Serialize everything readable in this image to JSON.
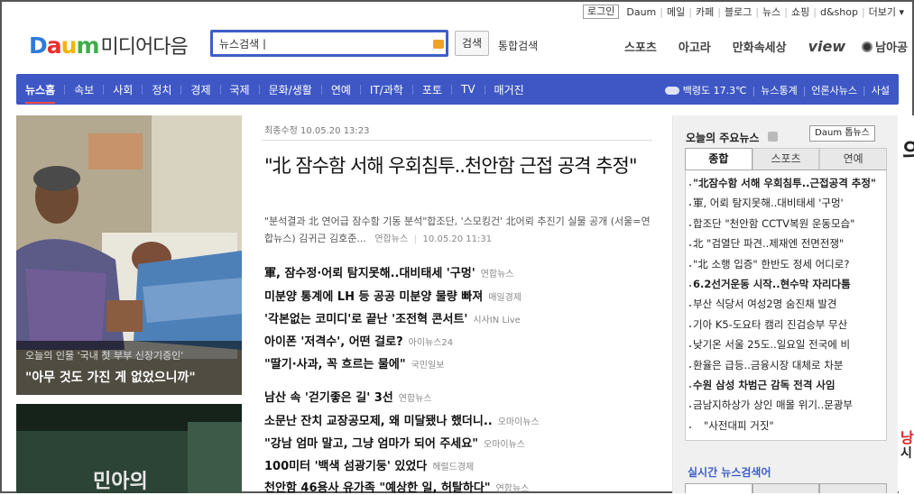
{
  "toplinks": {
    "login": "로그인",
    "items": [
      "Daum",
      "메일",
      "카페",
      "블로그",
      "뉴스",
      "쇼핑",
      "d&shop",
      "더보기"
    ]
  },
  "logo": {
    "brand": "Daum",
    "name": "미디어다음"
  },
  "search": {
    "value": "뉴스검색 |",
    "button": "검색",
    "total": "통합검색"
  },
  "services": {
    "sports": "스포츠",
    "agora": "아고라",
    "cartoon": "만화속세상",
    "view": "view",
    "namagong": "남아공"
  },
  "nav": {
    "items": [
      "뉴스홈",
      "속보",
      "사회",
      "정치",
      "경제",
      "국제",
      "문화/생활",
      "연예",
      "IT/과학",
      "포토",
      "TV",
      "매거진"
    ],
    "weather": "백령도 17.3℃",
    "right_items": [
      "뉴스통계",
      "언론사뉴스",
      "사설"
    ]
  },
  "photo1": {
    "subtitle": "오늘의 인물 '국내 첫 부부 신장기증인'",
    "caption": "\"아무 것도 가진 게 없었으니까\""
  },
  "photo2": {
    "text": "민아의"
  },
  "article": {
    "updated": "최종수정 10.05.20 13:23",
    "headline": "\"北 잠수함 서해 우회침투..천안함 근접 공격 추정\"",
    "summary": "\"분석결과 北 연어급 잠수함 기동 분석\"합조단, '스모킹건' 北어뢰 추진기 실물 공개 (서울=연합뉴스) 김귀근 김호준...",
    "summary_source": "연합뉴스",
    "summary_time": "10.05.20 11:31"
  },
  "news_group1": [
    {
      "title": "軍, 잠수정·어뢰 탐지못해..대비태세 '구멍'",
      "source": "연합뉴스"
    },
    {
      "title": "미분양 통계에 LH 등 공공 미분양 물량 빠져",
      "source": "매일경제"
    },
    {
      "title": "'각본없는 코미디'로 끝난 '조전혁 콘서트'",
      "source": "시사IN Live"
    },
    {
      "title": "아이폰 '저격수', 어떤 걸로?",
      "source": "아이뉴스24"
    },
    {
      "title": "\"딸기·사과, 꼭 흐르는 물에\"",
      "source": "국민일보"
    }
  ],
  "news_group2": [
    {
      "title": "남산 속 '걷기좋은 길' 3선",
      "source": "연합뉴스"
    },
    {
      "title": "소문난 잔치 교장공모제, 왜 미달됐나 했더니..",
      "source": "오마이뉴스"
    },
    {
      "title": "\"강남 엄마 말고, 그냥 엄마가 되어 주세요\"",
      "source": "오마이뉴스"
    },
    {
      "title": "100미터 '백색 섬광기둥' 있었다",
      "source": "헤럴드경제"
    },
    {
      "title": "천안함 46용사 유가족 \"예상한 일, 허탈하다\"",
      "source": "연합뉴스"
    }
  ],
  "right": {
    "title": "오늘의 주요뉴스",
    "toppick": "Daum 톱뉴스",
    "tabs": [
      "종합",
      "스포츠",
      "연예"
    ],
    "items": [
      {
        "t": "\"北잠수함 서해 우회침투..근접공격 추정\"",
        "b": true
      },
      {
        "t": "軍, 어뢰 탐지못해..대비태세 '구멍'",
        "b": false
      },
      {
        "t": "합조단 \"천안함 CCTV복원 운동모습\"",
        "b": false
      },
      {
        "t": "北 \"검열단 파견..제재엔 전면전쟁\"",
        "b": false
      },
      {
        "t": "\"北 소행 입증\" 한반도 정세 어디로?",
        "b": false
      },
      {
        "t": "6.2선거운동 시작..현수막 자리다툼",
        "b": true
      },
      {
        "t": "부산 식당서 여성2명 숨진채 발견",
        "b": false
      },
      {
        "t": "기아 K5-도요타 캠리 진검승부 무산",
        "b": false
      },
      {
        "t": "낮기온 서울 25도..일요일 전국에 비",
        "b": false
      },
      {
        "t": "환율은 급등..금융시장 대체로 차분",
        "b": false
      },
      {
        "t": "수원 삼성 차범근 감독 전격 사임",
        "b": true
      },
      {
        "t": "금남지하상가 상인 매몰 위기..문광부",
        "b": false
      },
      {
        "t": "\"사전대피 거짓\"",
        "b": false
      }
    ],
    "realtime_title": "실시간 뉴스검색어"
  },
  "ad": {
    "c1": "의",
    "c2": "낭",
    "c3": "시"
  }
}
